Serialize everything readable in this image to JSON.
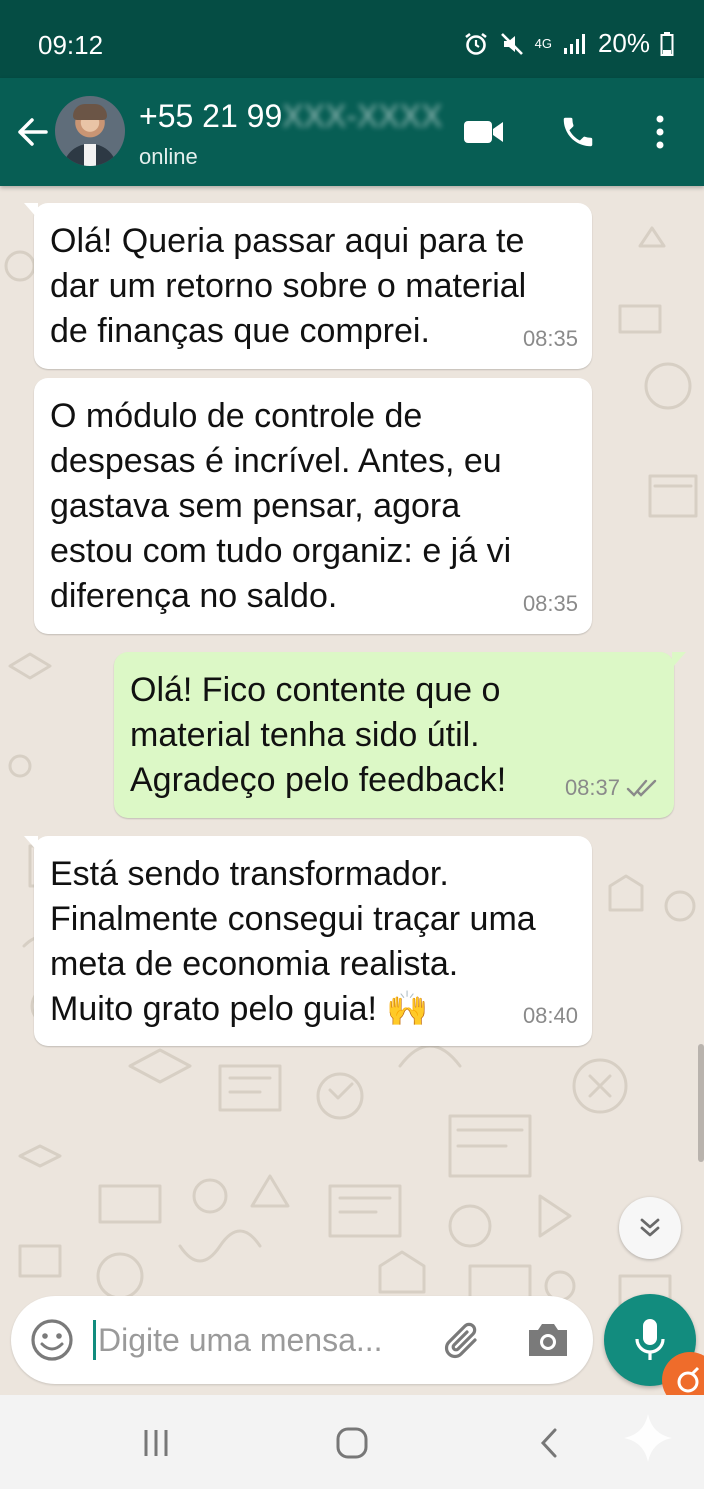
{
  "status_bar": {
    "time": "09:12",
    "network": "4G",
    "battery": "20%"
  },
  "header": {
    "contact_visible": "+55 21 99",
    "contact_masked": "XXX-XXXX",
    "status": "online"
  },
  "messages": [
    {
      "direction": "incoming",
      "text": "Olá! Queria passar aqui para te\ndar um retorno sobre o material\nde finanças que comprei.",
      "time": "08:35"
    },
    {
      "direction": "incoming",
      "text": "O módulo de controle de\ndespesas é incrível. Antes, eu\ngastava sem pensar, agora\nestou com tudo organiz: e já vi\ndiferença no saldo.",
      "time": "08:35"
    },
    {
      "direction": "outgoing",
      "text": "Olá! Fico contente que o\nmaterial tenha sido útil.\nAgradeço pelo feedback!",
      "time": "08:37",
      "read": true
    },
    {
      "direction": "incoming",
      "text": "Está sendo transformador.\nFinalmente consegui traçar uma\nmeta de economia realista.\nMuito grato pelo guia! 🙌",
      "time": "08:40"
    }
  ],
  "input": {
    "placeholder": "Digite uma mensa..."
  },
  "colors": {
    "header": "#075e54",
    "status_bar": "#054d44",
    "outgoing_bubble": "#dcf8c6",
    "incoming_bubble": "#ffffff",
    "accent": "#128c7e",
    "wallpaper": "#ece5dd"
  },
  "icons": [
    "back-arrow-icon",
    "video-call-icon",
    "phone-icon",
    "more-options-icon",
    "emoji-icon",
    "attach-icon",
    "camera-icon",
    "mic-icon",
    "scroll-down-icon",
    "double-check-icon"
  ]
}
